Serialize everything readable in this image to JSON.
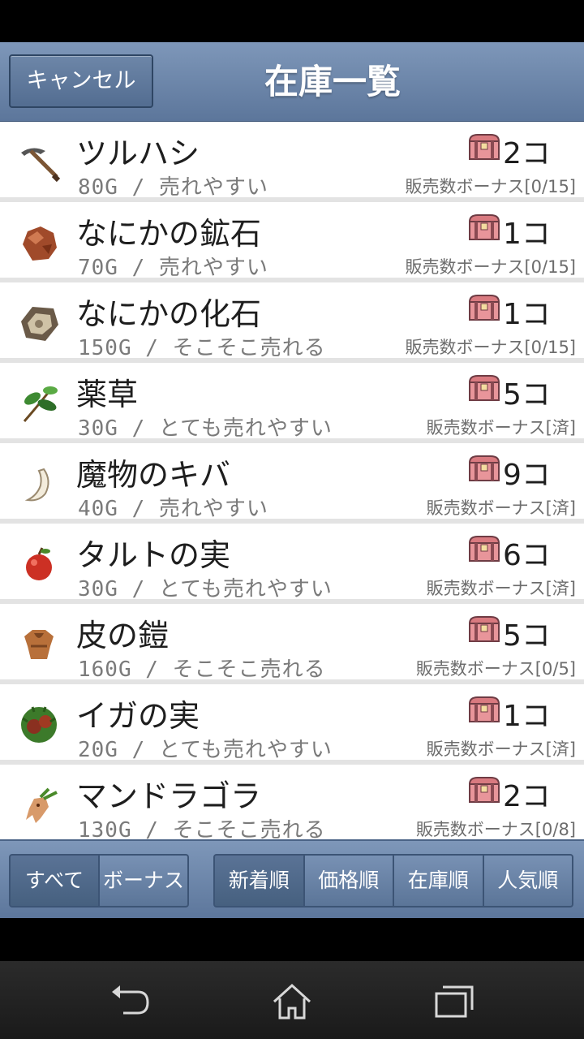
{
  "header": {
    "cancel_label": "キャンセル",
    "title": "在庫一覧"
  },
  "items": [
    {
      "icon": "pickaxe-icon",
      "name": "ツルハシ",
      "price_line": "80G / 売れやすい",
      "count": "2コ",
      "bonus": "販売数ボーナス[0/15]"
    },
    {
      "icon": "ore-icon",
      "name": "なにかの鉱石",
      "price_line": "70G / 売れやすい",
      "count": "1コ",
      "bonus": "販売数ボーナス[0/15]"
    },
    {
      "icon": "fossil-icon",
      "name": "なにかの化石",
      "price_line": "150G / そこそこ売れる",
      "count": "1コ",
      "bonus": "販売数ボーナス[0/15]"
    },
    {
      "icon": "herb-icon",
      "name": "薬草",
      "price_line": "30G / とても売れやすい",
      "count": "5コ",
      "bonus": "販売数ボーナス[済]"
    },
    {
      "icon": "fang-icon",
      "name": "魔物のキバ",
      "price_line": "40G / 売れやすい",
      "count": "9コ",
      "bonus": "販売数ボーナス[済]"
    },
    {
      "icon": "fruit-icon",
      "name": "タルトの実",
      "price_line": "30G / とても売れやすい",
      "count": "6コ",
      "bonus": "販売数ボーナス[済]"
    },
    {
      "icon": "leather-armor-icon",
      "name": "皮の鎧",
      "price_line": "160G / そこそこ売れる",
      "count": "5コ",
      "bonus": "販売数ボーナス[0/5]"
    },
    {
      "icon": "chestnut-icon",
      "name": "イガの実",
      "price_line": "20G / とても売れやすい",
      "count": "1コ",
      "bonus": "販売数ボーナス[済]"
    },
    {
      "icon": "mandragora-icon",
      "name": "マンドラゴラ",
      "price_line": "130G / そこそこ売れる",
      "count": "2コ",
      "bonus": "販売数ボーナス[0/8]"
    }
  ],
  "filters": [
    {
      "label": "すべて",
      "active": true
    },
    {
      "label": "ボーナス",
      "active": false
    }
  ],
  "sorts": [
    {
      "label": "新着順",
      "active": true
    },
    {
      "label": "価格順",
      "active": false
    },
    {
      "label": "在庫順",
      "active": false
    },
    {
      "label": "人気順",
      "active": false
    }
  ],
  "navbar": {
    "icons": [
      "back-icon",
      "home-icon",
      "recents-icon"
    ]
  },
  "colors": {
    "header": "#6c86aa",
    "accent": "#5a7396",
    "chest": "#d97a80"
  }
}
